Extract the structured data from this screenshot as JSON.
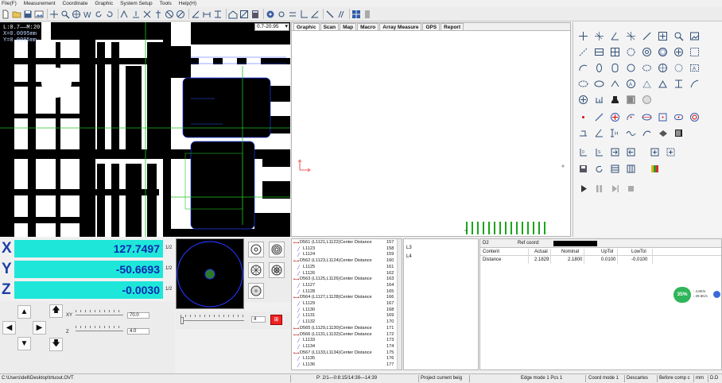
{
  "menu": [
    "File(F)",
    "Measurement",
    "Coordinate",
    "Graphic",
    "System Setup",
    "Tools",
    "Help(H)"
  ],
  "camera": {
    "line1": "L:",
    "line1_val": "0.7",
    "line1_sep": "——",
    "line1_right": "M:20.95",
    "line2": "X=0.0095mm",
    "line3": "Y=0.0095mm",
    "zoom_value": "0.7-20.95"
  },
  "tabs": [
    "Graphic",
    "Scan",
    "Map",
    "Macro",
    "Array Measure",
    "GPS",
    "Report"
  ],
  "active_tab": "Graphic",
  "coords": {
    "x_label": "X",
    "x_value": "127.7497",
    "y_label": "Y",
    "y_value": "-50.6693",
    "z_label": "Z",
    "z_value": "-0.0030",
    "unit_fraction": "1/2"
  },
  "joystick": {
    "xy_label": "XY",
    "xy_value": "70.0",
    "z_label": "Z",
    "z_value": "4.0"
  },
  "light": {
    "value": "4"
  },
  "features": [
    {
      "name": "D561 (L1121,L1122)Center Distance",
      "num": "157",
      "child": false
    },
    {
      "name": "L1123",
      "num": "158",
      "child": true
    },
    {
      "name": "L1124",
      "num": "159",
      "child": true
    },
    {
      "name": "D562 (L1123,L1124)Center Distance",
      "num": "160",
      "child": false
    },
    {
      "name": "L1125",
      "num": "161",
      "child": true
    },
    {
      "name": "L1126",
      "num": "162",
      "child": true
    },
    {
      "name": "D563 (L1125,L1126)Center Distance",
      "num": "163",
      "child": false
    },
    {
      "name": "L1127",
      "num": "164",
      "child": true
    },
    {
      "name": "L1128",
      "num": "165",
      "child": true
    },
    {
      "name": "D564 (L1127,L1128)Center Distance",
      "num": "166",
      "child": false
    },
    {
      "name": "L1129",
      "num": "167",
      "child": true
    },
    {
      "name": "L1130",
      "num": "168",
      "child": true
    },
    {
      "name": "L1131",
      "num": "169",
      "child": true
    },
    {
      "name": "L1132",
      "num": "170",
      "child": true
    },
    {
      "name": "D565 (L1129,L1130)Center Distance",
      "num": "171",
      "child": false
    },
    {
      "name": "D566 (L1131,L1132)Center Distance",
      "num": "172",
      "child": false
    },
    {
      "name": "L1133",
      "num": "173",
      "child": true
    },
    {
      "name": "L1134",
      "num": "174",
      "child": true
    },
    {
      "name": "D567 (L1133,L1134)Center Distance",
      "num": "175",
      "child": false
    },
    {
      "name": "L1135",
      "num": "176",
      "child": true
    },
    {
      "name": "L1136",
      "num": "177",
      "child": true
    }
  ],
  "sub_list": [
    "L3",
    "L4"
  ],
  "result": {
    "name": "D2",
    "ref_label": "Ref coord:",
    "columns": [
      "Content",
      "Actual",
      "Nominal",
      "UpTol",
      "LowTol"
    ],
    "row": [
      "Distance",
      "2.1829",
      "2.1800",
      "0.0100",
      "-0.0100"
    ]
  },
  "badge": {
    "percent": "35%",
    "up": "4.8K/s",
    "down": "29.5K/s",
    "up_arrow": "↑",
    "down_arrow": "↓"
  },
  "status": {
    "path": "C:\\Users\\dell\\Desktop\\trtuout.OVT",
    "progress": "P: 2/1—0:8:15/14:39—14:39",
    "project": "Project current beig",
    "edge": "Edge mode 1 Pcs 1",
    "coord": "Coord mode 1",
    "desc": "Descartes",
    "comp": "Before comp c",
    "unit": "mm",
    "dd": "D.D"
  },
  "colors": {
    "accent": "#1ee7d9",
    "coord_text": "#0b2bb0",
    "label": "#1c3fa8"
  }
}
